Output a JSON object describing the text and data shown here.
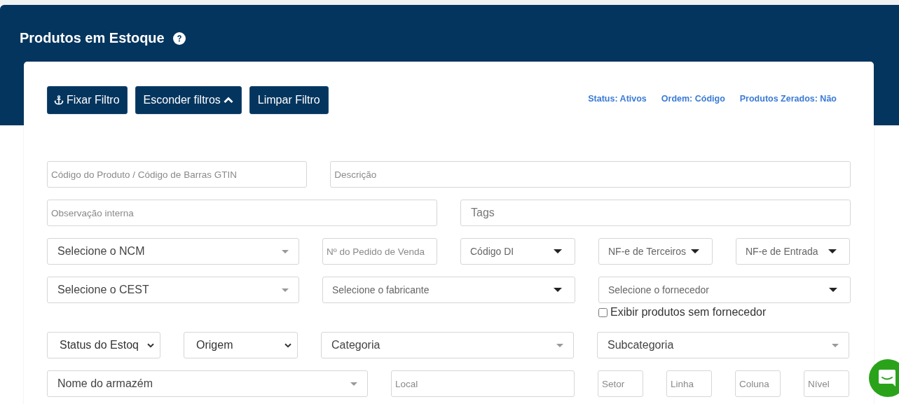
{
  "header": {
    "title": "Produtos em Estoque"
  },
  "toolbar": {
    "buttons": [
      {
        "kind": "anchor",
        "label": "Fixar Filtro"
      },
      {
        "kind": "toggle",
        "label": "Esconder filtros"
      },
      {
        "kind": "plain",
        "label": "Limpar Filtro"
      }
    ],
    "summary": [
      "Status: Ativos",
      "Ordem: Código",
      "Produtos Zerados: Não"
    ]
  },
  "filter_rows": [
    [
      {
        "kind": "text",
        "placeholder": "Código do Produto / Código de Barras GTIN"
      },
      {
        "kind": "text",
        "placeholder": "Descrição"
      }
    ],
    [
      {
        "kind": "text",
        "placeholder": "Observação interna"
      },
      {
        "kind": "tags",
        "placeholder": "Tags"
      }
    ],
    [
      {
        "kind": "search-select",
        "value": "Selecione o NCM"
      },
      {
        "kind": "text",
        "placeholder": "Nº do Pedido de Venda"
      },
      {
        "kind": "dropdown",
        "value": "Código DI"
      },
      {
        "kind": "dropdown",
        "value": "NF-e de Terceiros"
      },
      {
        "kind": "dropdown",
        "value": "NF-e de Entrada"
      }
    ],
    [
      {
        "kind": "search-select",
        "value": "Selecione o CEST"
      },
      {
        "kind": "dropdown",
        "value": "Selecione o fabricante"
      },
      {
        "kind": "dropdown",
        "value": "Selecione o fornecedor",
        "checkbox": {
          "label": "Exibir produtos sem fornecedor",
          "checked": false
        }
      }
    ],
    [
      {
        "kind": "native-select",
        "value": "Status do Estoq"
      },
      {
        "kind": "native-select",
        "value": "Origem"
      },
      {
        "kind": "search-select",
        "value": "Categoria"
      },
      {
        "kind": "search-select",
        "value": "Subcategoria"
      }
    ],
    [
      {
        "kind": "search-select",
        "value": "Nome do armazém"
      },
      {
        "kind": "text",
        "placeholder": "Local"
      },
      {
        "kind": "text",
        "placeholder": "Setor"
      },
      {
        "kind": "text",
        "placeholder": "Linha"
      },
      {
        "kind": "text",
        "placeholder": "Coluna"
      },
      {
        "kind": "text",
        "placeholder": "Nível"
      }
    ]
  ]
}
